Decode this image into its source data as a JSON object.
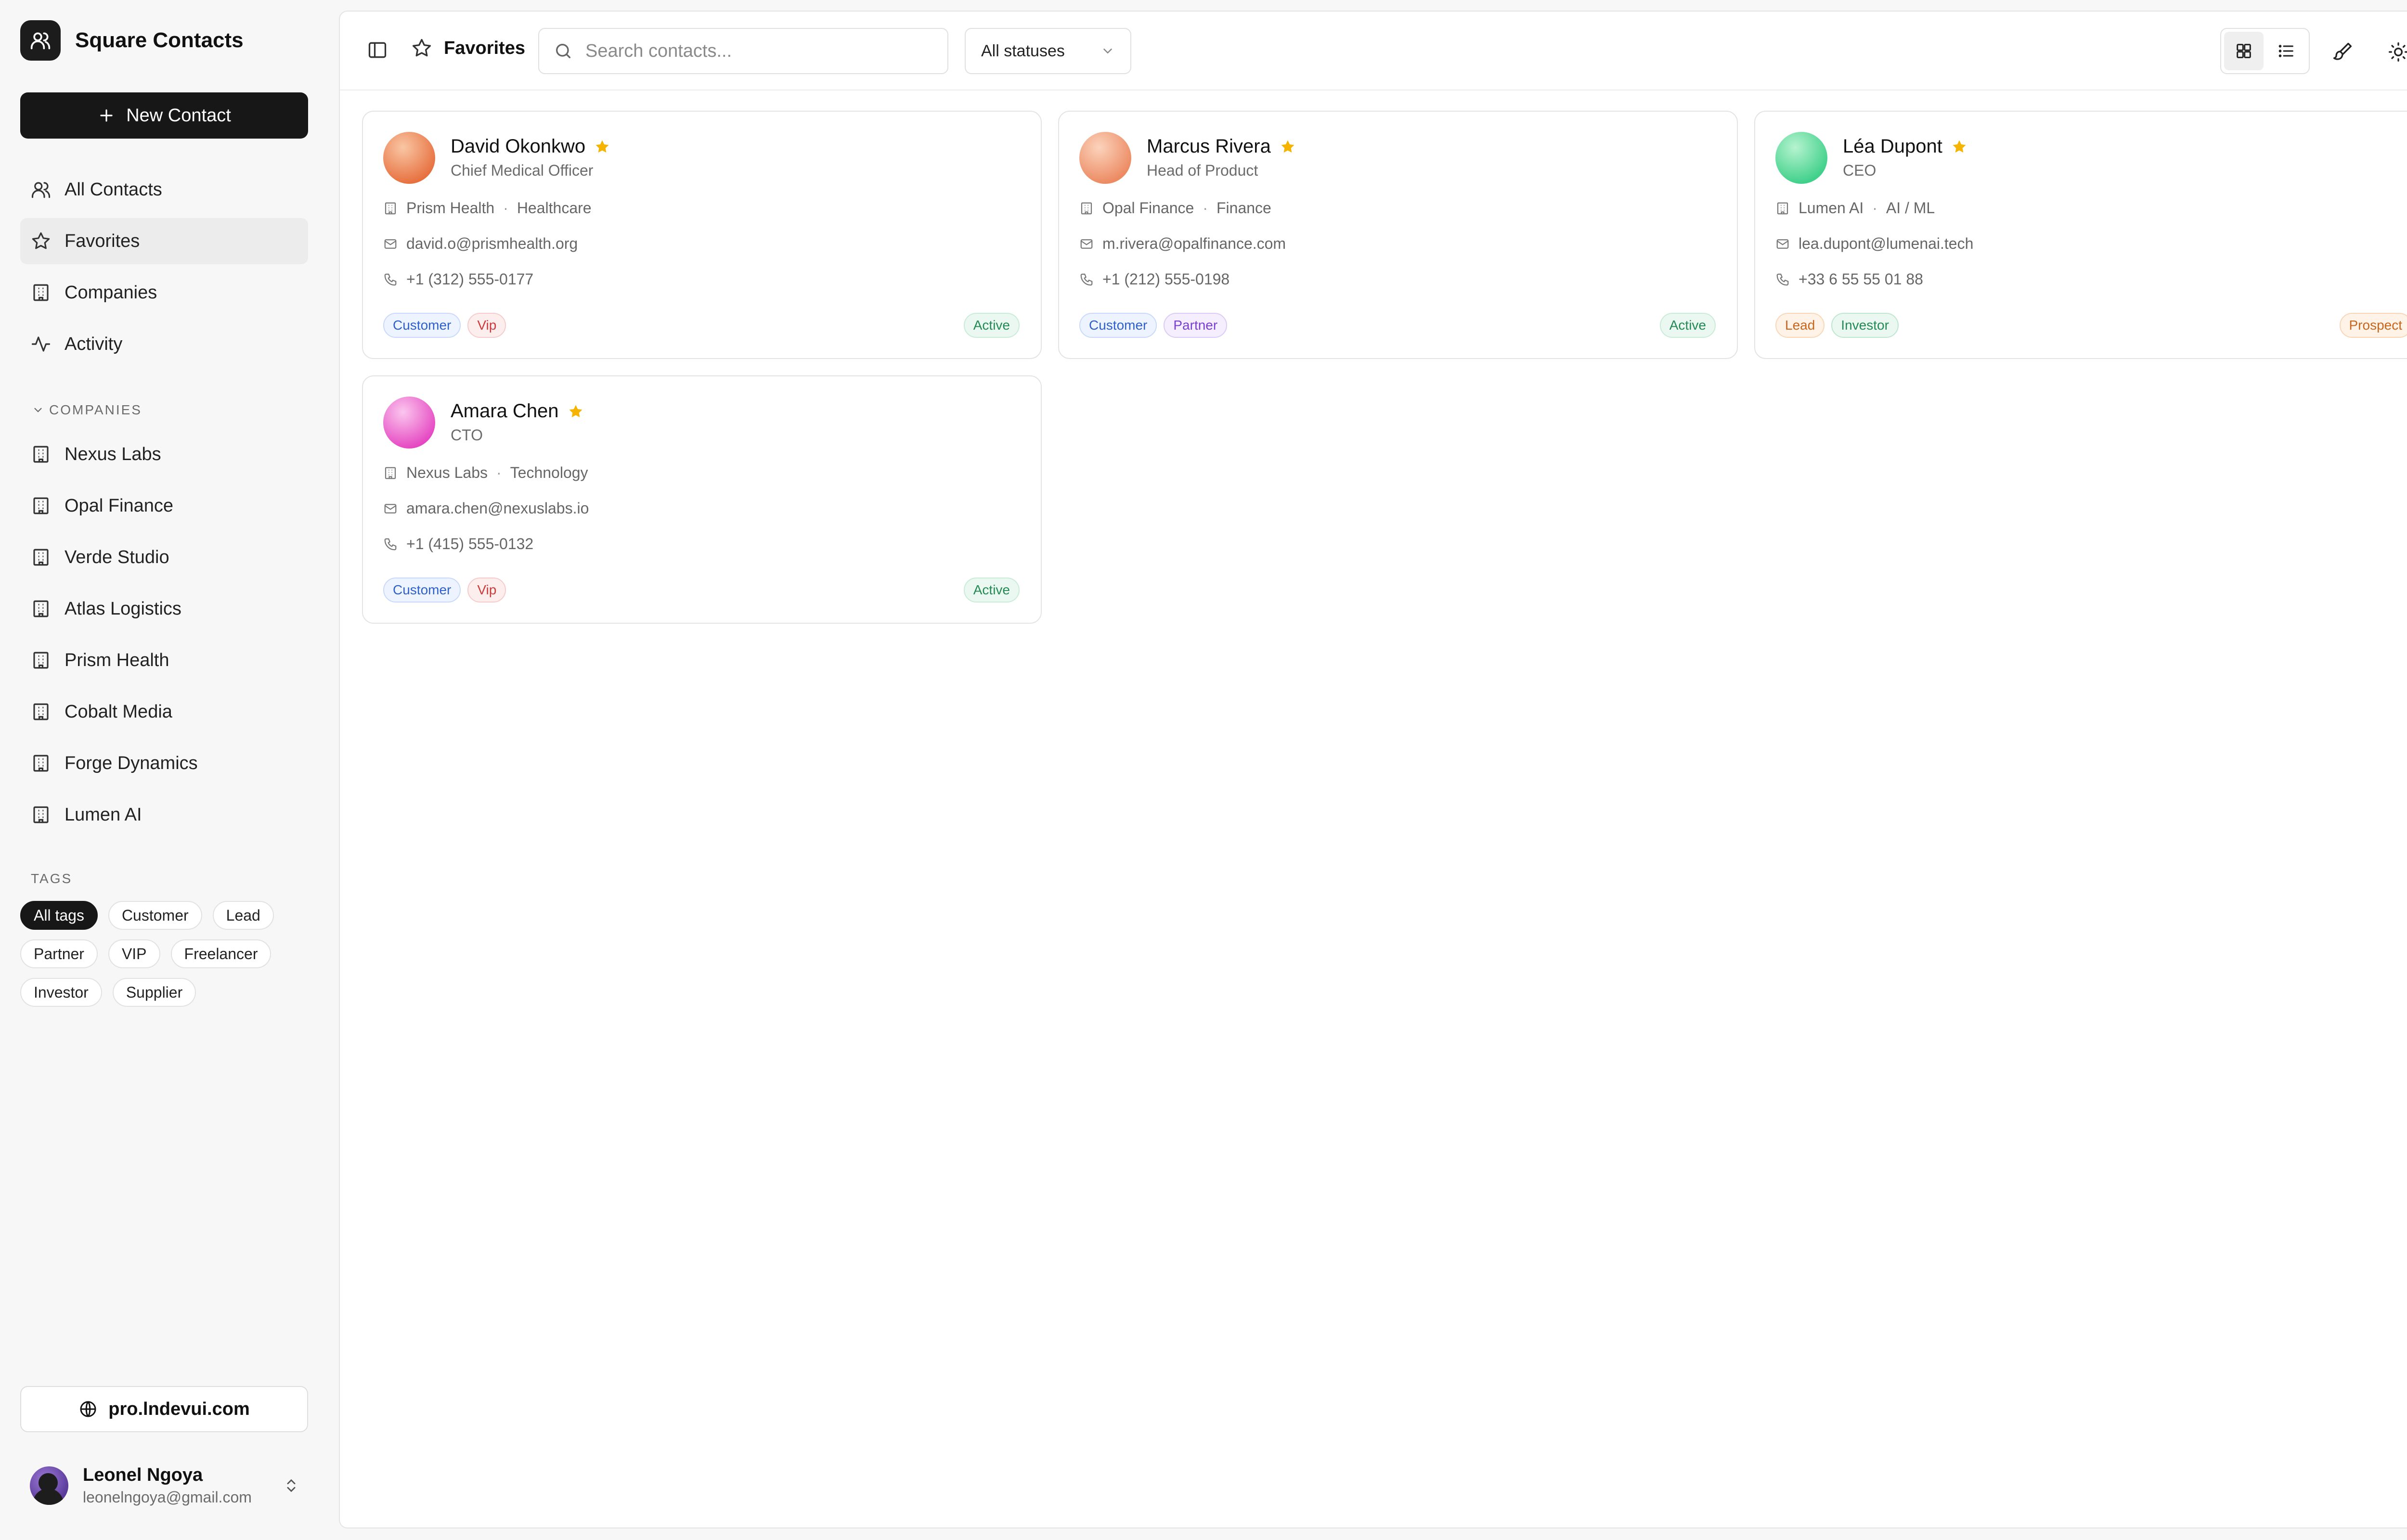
{
  "app": {
    "name": "Square Contacts"
  },
  "sidebar": {
    "new_contact_label": "New Contact",
    "nav": [
      {
        "label": "All Contacts",
        "icon": "users-icon"
      },
      {
        "label": "Favorites",
        "icon": "star-icon",
        "active": true
      },
      {
        "label": "Companies",
        "icon": "building-icon"
      },
      {
        "label": "Activity",
        "icon": "activity-icon"
      }
    ],
    "companies_label": "COMPANIES",
    "companies": [
      "Nexus Labs",
      "Opal Finance",
      "Verde Studio",
      "Atlas Logistics",
      "Prism Health",
      "Cobalt Media",
      "Forge Dynamics",
      "Lumen AI"
    ],
    "tags_label": "TAGS",
    "tags": [
      "All tags",
      "Customer",
      "Lead",
      "Partner",
      "VIP",
      "Freelancer",
      "Investor",
      "Supplier"
    ],
    "active_tag": "All tags",
    "site_label": "pro.lndevui.com",
    "user": {
      "name": "Leonel Ngoya",
      "email": "leonelngoya@gmail.com"
    }
  },
  "topbar": {
    "title": "Favorites",
    "search_placeholder": "Search contacts...",
    "status_filter": "All statuses",
    "view_mode": "grid"
  },
  "contacts": [
    {
      "name": "David Okonkwo",
      "role": "Chief Medical Officer",
      "company": "Prism Health",
      "industry": "Healthcare",
      "email": "david.o@prismhealth.org",
      "phone": "+1 (312) 555-0177",
      "tags": [
        "Customer",
        "Vip"
      ],
      "status": "Active",
      "avatar_colors": [
        "#f9c6a4",
        "#e7703f"
      ],
      "favorite": true
    },
    {
      "name": "Marcus Rivera",
      "role": "Head of Product",
      "company": "Opal Finance",
      "industry": "Finance",
      "email": "m.rivera@opalfinance.com",
      "phone": "+1 (212) 555-0198",
      "tags": [
        "Customer",
        "Partner"
      ],
      "status": "Active",
      "avatar_colors": [
        "#fbd3bc",
        "#ec8a62"
      ],
      "favorite": true
    },
    {
      "name": "Léa Dupont",
      "role": "CEO",
      "company": "Lumen AI",
      "industry": "AI / ML",
      "email": "lea.dupont@lumenai.tech",
      "phone": "+33 6 55 55 01 88",
      "tags": [
        "Lead",
        "Investor"
      ],
      "status": "Prospect",
      "avatar_colors": [
        "#b6f3cf",
        "#3fd08a"
      ],
      "favorite": true
    },
    {
      "name": "Amara Chen",
      "role": "CTO",
      "company": "Nexus Labs",
      "industry": "Technology",
      "email": "amara.chen@nexuslabs.io",
      "phone": "+1 (415) 555-0132",
      "tags": [
        "Customer",
        "Vip"
      ],
      "status": "Active",
      "avatar_colors": [
        "#fbc6ee",
        "#e548c2"
      ],
      "favorite": true
    }
  ],
  "colors": {
    "star": "#f5b400",
    "primary": "#171717"
  }
}
